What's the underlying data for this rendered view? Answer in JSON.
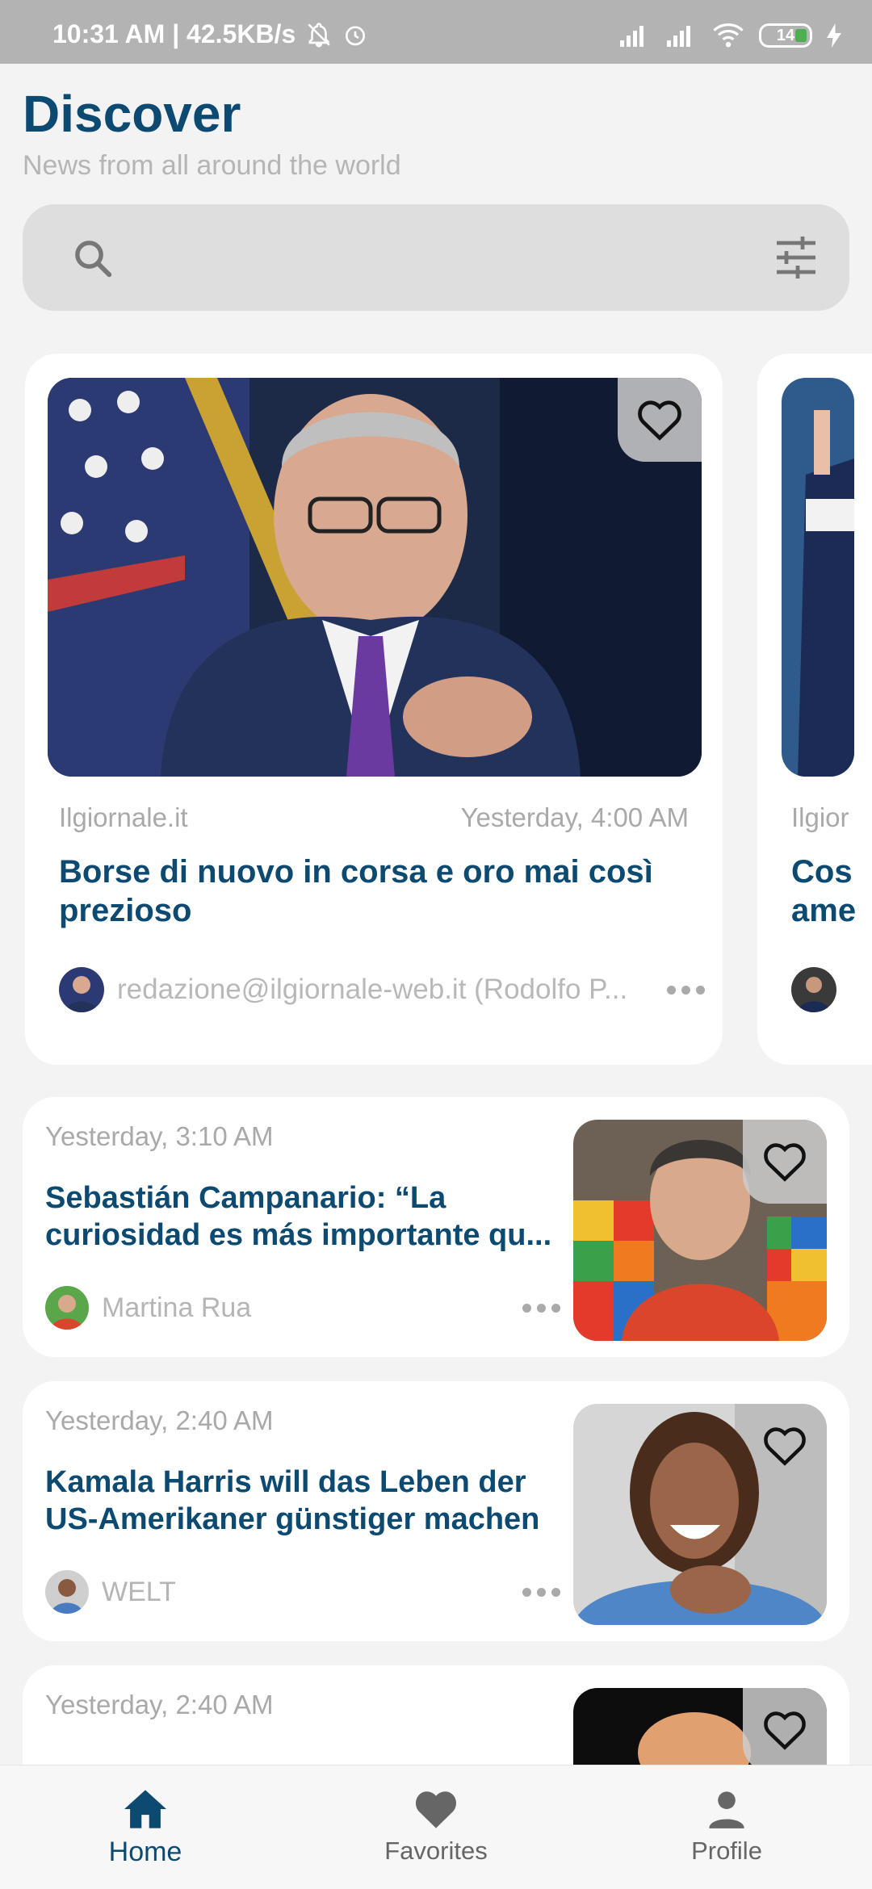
{
  "status_bar": {
    "time_speed": "10:31 AM | 42.5KB/s",
    "battery": "14"
  },
  "header": {
    "title": "Discover",
    "subtitle": "News from all around the world"
  },
  "search": {
    "value": "",
    "placeholder": ""
  },
  "featured": [
    {
      "source": "Ilgiornale.it",
      "time": "Yesterday, 4:00 AM",
      "headline": "Borse di nuovo in corsa e oro mai così prezioso",
      "author": "redazione@ilgiornale-web.it (Rodolfo P..."
    },
    {
      "source": "Ilgior",
      "headline_l1": "Cos",
      "headline_l2": "ame"
    }
  ],
  "articles": [
    {
      "time": "Yesterday, 3:10 AM",
      "headline_l1": "Sebastián Campanario: “La",
      "headline_l2": "curiosidad es más importante qu...",
      "author": "Martina Rua"
    },
    {
      "time": "Yesterday, 2:40 AM",
      "headline_l1": "Kamala Harris will das Leben der",
      "headline_l2": "US-Amerikaner günstiger machen",
      "author": "WELT"
    },
    {
      "time": "Yesterday, 2:40 AM"
    }
  ],
  "nav": {
    "home": "Home",
    "favorites": "Favorites",
    "profile": "Profile"
  },
  "colors": {
    "accent": "#0c4a72",
    "muted": "#a9a9a9",
    "status_bar": "#b3b3b3"
  }
}
